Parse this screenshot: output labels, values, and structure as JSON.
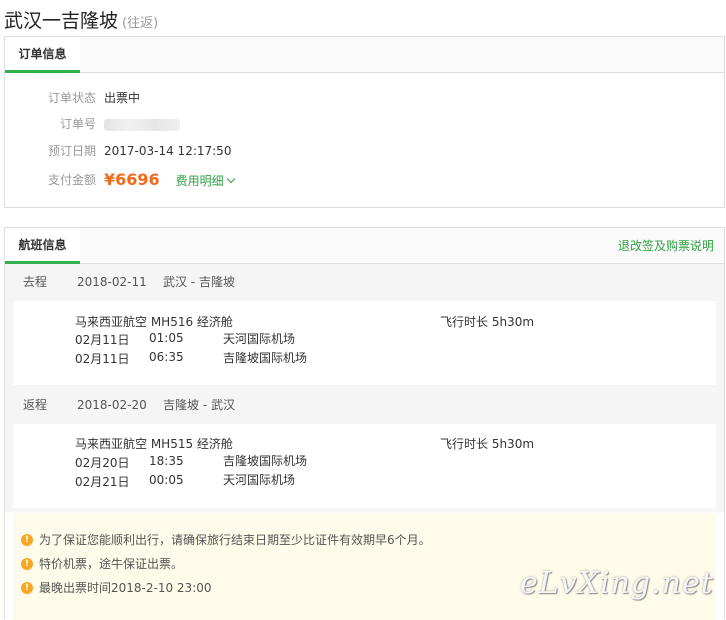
{
  "page": {
    "title": "武汉一吉隆坡",
    "title_sub": "(往返)"
  },
  "order": {
    "tab": "订单信息",
    "status_label": "订单状态",
    "status_value": "出票中",
    "number_label": "订单号",
    "date_label": "预订日期",
    "date_value": "2017-03-14 12:17:50",
    "amount_label": "支付金额",
    "amount_value": "¥6696",
    "fee_detail": "费用明细"
  },
  "flights": {
    "tab": "航班信息",
    "policy_link": "退改签及购票说明",
    "segments": [
      {
        "type": "去程",
        "date": "2018-02-11",
        "route": "武汉 - 吉隆坡",
        "airline": "马来西亚航空 MH516 经济舱",
        "duration": "飞行时长 5h30m",
        "dep_date": "02月11日",
        "dep_time": "01:05",
        "dep_airport": "天河国际机场",
        "arr_date": "02月11日",
        "arr_time": "06:35",
        "arr_airport": "吉隆坡国际机场"
      },
      {
        "type": "返程",
        "date": "2018-02-20",
        "route": "吉隆坡 - 武汉",
        "airline": "马来西亚航空 MH515 经济舱",
        "duration": "飞行时长 5h30m",
        "dep_date": "02月20日",
        "dep_time": "18:35",
        "dep_airport": "吉隆坡国际机场",
        "arr_date": "02月21日",
        "arr_time": "00:05",
        "arr_airport": "天河国际机场"
      }
    ]
  },
  "notices": [
    "为了保证您能顺利出行，请确保旅行结束日期至少比证件有效期早6个月。",
    "特价机票，途牛保证出票。",
    "最晚出票时间2018-2-10 23:00"
  ],
  "watermark": "eLvXing.net",
  "colors": {
    "accent": "#2fb24a",
    "price": "#f46a1c",
    "link": "#2fa043",
    "warning": "#f5a623"
  }
}
